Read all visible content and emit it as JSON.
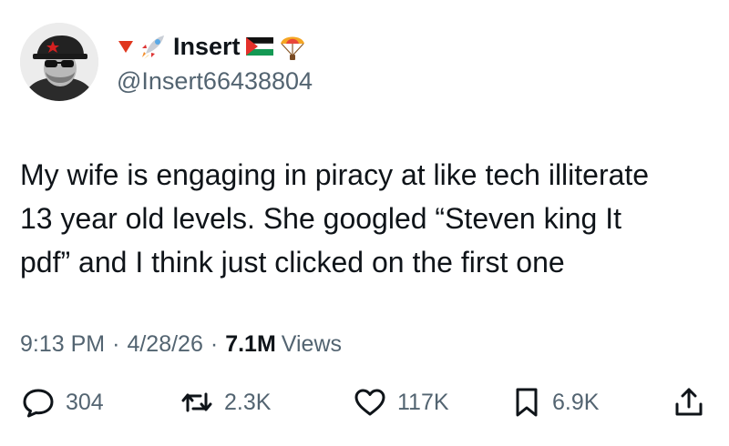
{
  "author": {
    "display_name": "Insert",
    "handle": "@Insert66438804",
    "name_emojis_before": [
      "red-triangle-down-emoji",
      "rocket-emoji"
    ],
    "name_emojis_after": [
      "palestine-flag-emoji",
      "parachute-emoji"
    ],
    "avatar": "avatar-man-cap-sunglasses"
  },
  "tweet": {
    "text": "My wife is engaging in piracy at like tech illiterate\n13 year old levels. She googled “Steven king It\npdf” and I think just clicked on the first one"
  },
  "meta": {
    "time": "9:13 PM",
    "separator": "·",
    "date": "4/28/26",
    "views_count": "7.1M",
    "views_label": "Views"
  },
  "actions": {
    "replies": "304",
    "reposts": "2.3K",
    "likes": "117K",
    "bookmarks": "6.9K"
  },
  "colors": {
    "text_primary": "#0f1419",
    "text_secondary": "#536471",
    "background": "#ffffff"
  }
}
